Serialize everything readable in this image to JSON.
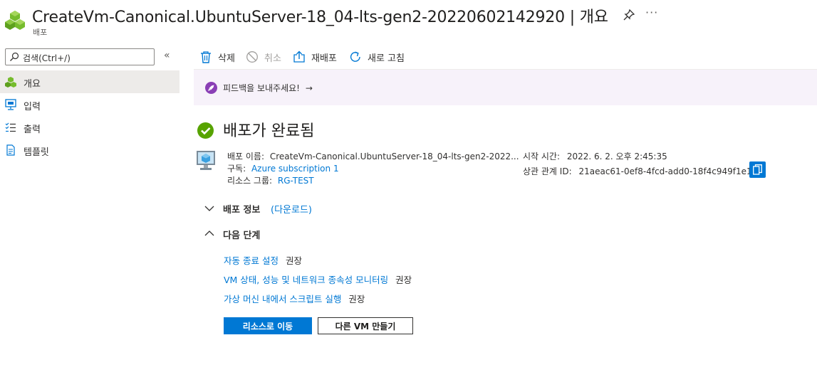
{
  "header": {
    "title": "CreateVm-Canonical.UbuntuServer-18_04-lts-gen2-20220602142920 | 개요",
    "subtitle": "배포",
    "more": "···"
  },
  "sidebar": {
    "search_placeholder": "검색(Ctrl+/)",
    "collapse": "«",
    "items": [
      {
        "label": "개요",
        "icon": "deployment-icon",
        "selected": true
      },
      {
        "label": "입력",
        "icon": "input-icon",
        "selected": false
      },
      {
        "label": "출력",
        "icon": "output-icon",
        "selected": false
      },
      {
        "label": "템플릿",
        "icon": "template-icon",
        "selected": false
      }
    ]
  },
  "toolbar": {
    "delete": "삭제",
    "cancel": "취소",
    "redeploy": "재배포",
    "refresh": "새로 고침"
  },
  "feedback": {
    "text": "피드백을 보내주세요!",
    "arrow": "→"
  },
  "status": {
    "title": "배포가 완료됨",
    "color": "#57a300"
  },
  "details": {
    "deployment_name_key": "배포 이름:",
    "deployment_name": "CreateVm-Canonical.UbuntuServer-18_04-lts-gen2-2022...",
    "subscription_key": "구독:",
    "subscription": "Azure subscription 1",
    "resource_group_key": "리소스 그룹:",
    "resource_group": "RG-TEST",
    "start_time_key": "시작 시간:",
    "start_time": "2022. 6. 2. 오후 2:45:35",
    "correlation_key": "상관 관계 ID:",
    "correlation_id": "21aeac61-0ef8-4fcd-add0-18f4c949f1e1"
  },
  "sections": {
    "deployment_info": "배포 정보",
    "download": "(다운로드)",
    "next_steps": "다음 단계"
  },
  "next_steps": [
    {
      "link": "자동 종료 설정",
      "tag": "권장"
    },
    {
      "link": "VM 상태, 성능 및 네트워크 종속성 모니터링",
      "tag": "권장"
    },
    {
      "link": "가상 머신 내에서 스크립트 실행",
      "tag": "권장"
    }
  ],
  "buttons": {
    "go_to_resource": "리소스로 이동",
    "create_another_vm": "다른 VM 만들기"
  },
  "colors": {
    "accent": "#0078d4",
    "selected_bg": "#edebe9",
    "feedback_bg": "#f7f2fa",
    "feedback_icon": "#8a3fb5"
  }
}
